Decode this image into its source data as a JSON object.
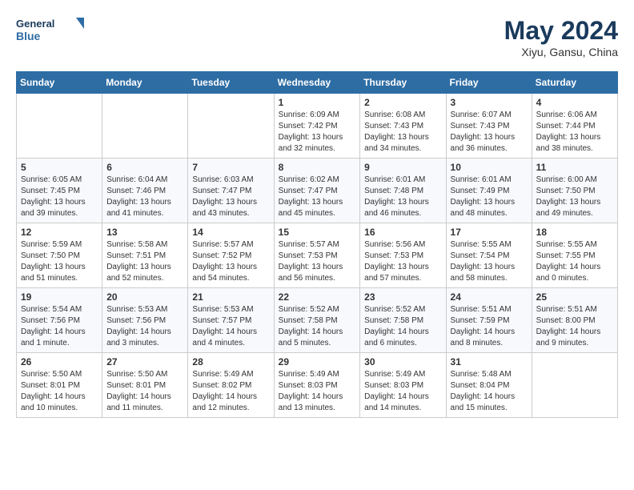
{
  "header": {
    "logo_general": "General",
    "logo_blue": "Blue",
    "title": "May 2024",
    "subtitle": "Xiyu, Gansu, China"
  },
  "weekdays": [
    "Sunday",
    "Monday",
    "Tuesday",
    "Wednesday",
    "Thursday",
    "Friday",
    "Saturday"
  ],
  "weeks": [
    [
      {
        "day": "",
        "sunrise": "",
        "sunset": "",
        "daylight": ""
      },
      {
        "day": "",
        "sunrise": "",
        "sunset": "",
        "daylight": ""
      },
      {
        "day": "",
        "sunrise": "",
        "sunset": "",
        "daylight": ""
      },
      {
        "day": "1",
        "sunrise": "Sunrise: 6:09 AM",
        "sunset": "Sunset: 7:42 PM",
        "daylight": "Daylight: 13 hours and 32 minutes."
      },
      {
        "day": "2",
        "sunrise": "Sunrise: 6:08 AM",
        "sunset": "Sunset: 7:43 PM",
        "daylight": "Daylight: 13 hours and 34 minutes."
      },
      {
        "day": "3",
        "sunrise": "Sunrise: 6:07 AM",
        "sunset": "Sunset: 7:43 PM",
        "daylight": "Daylight: 13 hours and 36 minutes."
      },
      {
        "day": "4",
        "sunrise": "Sunrise: 6:06 AM",
        "sunset": "Sunset: 7:44 PM",
        "daylight": "Daylight: 13 hours and 38 minutes."
      }
    ],
    [
      {
        "day": "5",
        "sunrise": "Sunrise: 6:05 AM",
        "sunset": "Sunset: 7:45 PM",
        "daylight": "Daylight: 13 hours and 39 minutes."
      },
      {
        "day": "6",
        "sunrise": "Sunrise: 6:04 AM",
        "sunset": "Sunset: 7:46 PM",
        "daylight": "Daylight: 13 hours and 41 minutes."
      },
      {
        "day": "7",
        "sunrise": "Sunrise: 6:03 AM",
        "sunset": "Sunset: 7:47 PM",
        "daylight": "Daylight: 13 hours and 43 minutes."
      },
      {
        "day": "8",
        "sunrise": "Sunrise: 6:02 AM",
        "sunset": "Sunset: 7:47 PM",
        "daylight": "Daylight: 13 hours and 45 minutes."
      },
      {
        "day": "9",
        "sunrise": "Sunrise: 6:01 AM",
        "sunset": "Sunset: 7:48 PM",
        "daylight": "Daylight: 13 hours and 46 minutes."
      },
      {
        "day": "10",
        "sunrise": "Sunrise: 6:01 AM",
        "sunset": "Sunset: 7:49 PM",
        "daylight": "Daylight: 13 hours and 48 minutes."
      },
      {
        "day": "11",
        "sunrise": "Sunrise: 6:00 AM",
        "sunset": "Sunset: 7:50 PM",
        "daylight": "Daylight: 13 hours and 49 minutes."
      }
    ],
    [
      {
        "day": "12",
        "sunrise": "Sunrise: 5:59 AM",
        "sunset": "Sunset: 7:50 PM",
        "daylight": "Daylight: 13 hours and 51 minutes."
      },
      {
        "day": "13",
        "sunrise": "Sunrise: 5:58 AM",
        "sunset": "Sunset: 7:51 PM",
        "daylight": "Daylight: 13 hours and 52 minutes."
      },
      {
        "day": "14",
        "sunrise": "Sunrise: 5:57 AM",
        "sunset": "Sunset: 7:52 PM",
        "daylight": "Daylight: 13 hours and 54 minutes."
      },
      {
        "day": "15",
        "sunrise": "Sunrise: 5:57 AM",
        "sunset": "Sunset: 7:53 PM",
        "daylight": "Daylight: 13 hours and 56 minutes."
      },
      {
        "day": "16",
        "sunrise": "Sunrise: 5:56 AM",
        "sunset": "Sunset: 7:53 PM",
        "daylight": "Daylight: 13 hours and 57 minutes."
      },
      {
        "day": "17",
        "sunrise": "Sunrise: 5:55 AM",
        "sunset": "Sunset: 7:54 PM",
        "daylight": "Daylight: 13 hours and 58 minutes."
      },
      {
        "day": "18",
        "sunrise": "Sunrise: 5:55 AM",
        "sunset": "Sunset: 7:55 PM",
        "daylight": "Daylight: 14 hours and 0 minutes."
      }
    ],
    [
      {
        "day": "19",
        "sunrise": "Sunrise: 5:54 AM",
        "sunset": "Sunset: 7:56 PM",
        "daylight": "Daylight: 14 hours and 1 minute."
      },
      {
        "day": "20",
        "sunrise": "Sunrise: 5:53 AM",
        "sunset": "Sunset: 7:56 PM",
        "daylight": "Daylight: 14 hours and 3 minutes."
      },
      {
        "day": "21",
        "sunrise": "Sunrise: 5:53 AM",
        "sunset": "Sunset: 7:57 PM",
        "daylight": "Daylight: 14 hours and 4 minutes."
      },
      {
        "day": "22",
        "sunrise": "Sunrise: 5:52 AM",
        "sunset": "Sunset: 7:58 PM",
        "daylight": "Daylight: 14 hours and 5 minutes."
      },
      {
        "day": "23",
        "sunrise": "Sunrise: 5:52 AM",
        "sunset": "Sunset: 7:58 PM",
        "daylight": "Daylight: 14 hours and 6 minutes."
      },
      {
        "day": "24",
        "sunrise": "Sunrise: 5:51 AM",
        "sunset": "Sunset: 7:59 PM",
        "daylight": "Daylight: 14 hours and 8 minutes."
      },
      {
        "day": "25",
        "sunrise": "Sunrise: 5:51 AM",
        "sunset": "Sunset: 8:00 PM",
        "daylight": "Daylight: 14 hours and 9 minutes."
      }
    ],
    [
      {
        "day": "26",
        "sunrise": "Sunrise: 5:50 AM",
        "sunset": "Sunset: 8:01 PM",
        "daylight": "Daylight: 14 hours and 10 minutes."
      },
      {
        "day": "27",
        "sunrise": "Sunrise: 5:50 AM",
        "sunset": "Sunset: 8:01 PM",
        "daylight": "Daylight: 14 hours and 11 minutes."
      },
      {
        "day": "28",
        "sunrise": "Sunrise: 5:49 AM",
        "sunset": "Sunset: 8:02 PM",
        "daylight": "Daylight: 14 hours and 12 minutes."
      },
      {
        "day": "29",
        "sunrise": "Sunrise: 5:49 AM",
        "sunset": "Sunset: 8:03 PM",
        "daylight": "Daylight: 14 hours and 13 minutes."
      },
      {
        "day": "30",
        "sunrise": "Sunrise: 5:49 AM",
        "sunset": "Sunset: 8:03 PM",
        "daylight": "Daylight: 14 hours and 14 minutes."
      },
      {
        "day": "31",
        "sunrise": "Sunrise: 5:48 AM",
        "sunset": "Sunset: 8:04 PM",
        "daylight": "Daylight: 14 hours and 15 minutes."
      },
      {
        "day": "",
        "sunrise": "",
        "sunset": "",
        "daylight": ""
      }
    ]
  ]
}
